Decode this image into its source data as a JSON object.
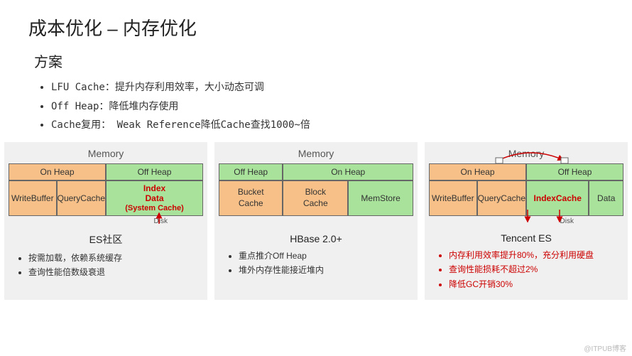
{
  "title": "成本优化  –   内存优化",
  "subtitle": "方案",
  "top_bullets": [
    "LFU Cache：提升内存利用效率，大小动态可调",
    "Off Heap：降低堆内存使用",
    "Cache复用：  Weak Reference降低Cache查找1000~倍"
  ],
  "cols": [
    {
      "mem": "Memory",
      "onheap": "On Heap",
      "offheap": "Off Heap",
      "cells": {
        "wb": "WriteBuffer",
        "qc": "QueryCache",
        "idx1": "Index",
        "idx2": "Data",
        "idx3": "(System Cache)"
      },
      "disk": "Disk",
      "caption": "ES社区",
      "notes": [
        "按需加载，依赖系统缓存",
        "查询性能倍数级衰退"
      ]
    },
    {
      "mem": "Memory",
      "offheap": "Off Heap",
      "onheap": "On Heap",
      "cells": {
        "bc": "Bucket",
        "bc2": "Cache",
        "blc": "Block",
        "blc2": "Cache",
        "ms": "MemStore"
      },
      "caption": "HBase 2.0+",
      "notes": [
        "重点推介Off Heap",
        "堆外内存性能接近堆内"
      ]
    },
    {
      "mem": "Memory",
      "onheap": "On Heap",
      "offheap": "Off Heap",
      "cells": {
        "wb": "WriteBuffer",
        "qc": "QueryCache",
        "ic": "IndexCache",
        "data": "Data"
      },
      "disk": "Disk",
      "caption": "Tencent ES",
      "notes": [
        "内存利用效率提升80%，充分利用硬盘",
        "查询性能损耗不超过2%",
        "降低GC开销30%"
      ]
    }
  ],
  "watermark": "@ITPUB博客",
  "chart_data": {
    "type": "table",
    "title": "内存优化对比 (Memory Optimization Comparison)",
    "architectures": [
      {
        "name": "ES社区",
        "on_heap": [
          "WriteBuffer",
          "QueryCache"
        ],
        "off_heap": [
          "Index Data (System Cache)"
        ],
        "flow": "Disk → Off Heap Index",
        "drawbacks": [
          "按需加载，依赖系统缓存",
          "查询性能倍数级衰退"
        ]
      },
      {
        "name": "HBase 2.0+",
        "off_heap": [
          "Bucket Cache"
        ],
        "on_heap": [
          "Block Cache",
          "MemStore"
        ],
        "advantages": [
          "重点推介Off Heap",
          "堆外内存性能接近堆内"
        ]
      },
      {
        "name": "Tencent ES",
        "on_heap": [
          "WriteBuffer",
          "QueryCache"
        ],
        "off_heap": [
          "IndexCache",
          "Data"
        ],
        "flow": "QueryCache ↔ IndexCache, IndexCache → Disk",
        "metrics": {
          "memory_efficiency_gain_pct": 80,
          "query_perf_loss_max_pct": 2,
          "gc_overhead_reduction_pct": 30
        }
      }
    ]
  }
}
